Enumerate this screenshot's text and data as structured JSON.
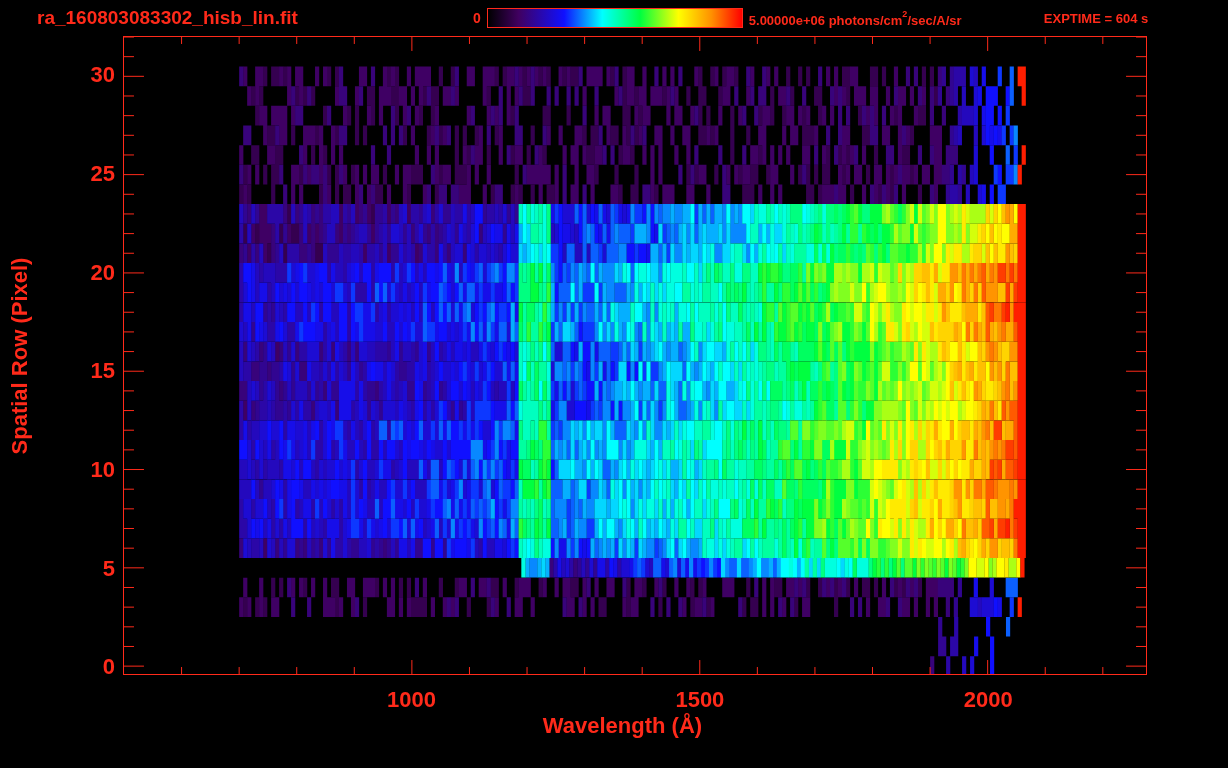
{
  "header": {
    "filename": "ra_160803083302_hisb_lin.fit",
    "colorbar": {
      "min_label": "0",
      "max_label": "5.00000e+06 photons/cm$^{2}$/sec/A/sr"
    },
    "exposure": "EXPTIME = 604 s"
  },
  "plot": {
    "ylabel": "Spatial Row (Pixel)",
    "yticks": [
      "30",
      "25",
      "20",
      "15",
      "10",
      "5",
      "0"
    ],
    "xticks": [
      "1000",
      "1500",
      "2000"
    ],
    "xlabel": "Wavelength (Å)"
  }
}
